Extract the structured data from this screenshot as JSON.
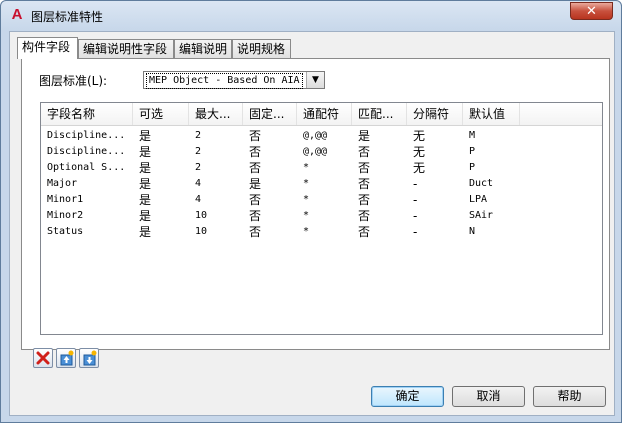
{
  "window": {
    "title": "图层标准特性",
    "close_glyph": "✕",
    "app_glyph": "A"
  },
  "tabs": [
    {
      "label": "构件字段",
      "active": true
    },
    {
      "label": "编辑说明性字段",
      "active": false
    },
    {
      "label": "编辑说明",
      "active": false
    },
    {
      "label": "说明规格",
      "active": false
    }
  ],
  "standard": {
    "label": "图层标准(L):",
    "value": "MEP Object - Based On AIA",
    "arrow": "▼"
  },
  "table": {
    "columns": [
      "字段名称",
      "可选",
      "最大...",
      "固定...",
      "通配符",
      "匹配...",
      "分隔符",
      "默认值"
    ],
    "rows": [
      [
        "Discipline...",
        "是",
        "2",
        "否",
        "@,@@",
        "是",
        "无",
        "M"
      ],
      [
        "Discipline...",
        "是",
        "2",
        "否",
        "@,@@",
        "否",
        "无",
        "P"
      ],
      [
        "Optional S...",
        "是",
        "2",
        "否",
        "*",
        "否",
        "无",
        "P"
      ],
      [
        "Major",
        "是",
        "4",
        "是",
        "*",
        "否",
        "-",
        "Duct"
      ],
      [
        "Minor1",
        "是",
        "4",
        "否",
        "*",
        "否",
        "-",
        "LPA"
      ],
      [
        "Minor2",
        "是",
        "10",
        "否",
        "*",
        "否",
        "-",
        "SAir"
      ],
      [
        "Status",
        "是",
        "10",
        "否",
        "*",
        "否",
        "-",
        "N"
      ]
    ]
  },
  "tools": {
    "delete_icon": "delete-icon",
    "move_up_icon": "move-up-icon",
    "move_down_icon": "move-down-icon"
  },
  "buttons": {
    "ok": "确定",
    "cancel": "取消",
    "help": "帮助"
  }
}
